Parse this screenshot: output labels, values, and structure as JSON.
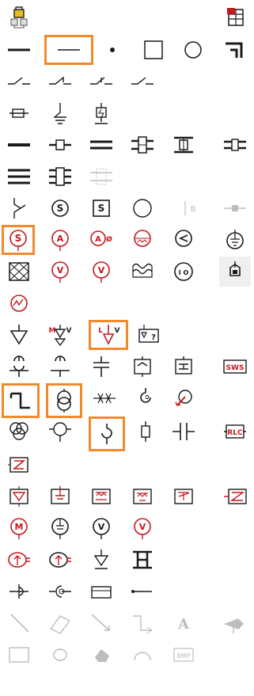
{
  "toolbar": {
    "top_left_icon": "lock-network-icon",
    "top_right_icon": "table-grid-icon"
  },
  "labels": {
    "b": "B",
    "mv": "M",
    "vv": "V",
    "lv_l": "L",
    "lv_v": "V",
    "qm": "?",
    "sws": "SWS",
    "rlc": "RLC",
    "io": "I O",
    "bmp": "BMP",
    "text_a": "A",
    "s1": "S",
    "s2": "S",
    "s3": "S",
    "a1": "A",
    "ad_a": "A",
    "ad_d": "Ø",
    "v1": "V",
    "v2": "V",
    "m": "M",
    "v3": "V",
    "v4": "V"
  },
  "selected_tools": [
    "line-tool",
    "meter-s-tool",
    "step-line-tool",
    "transformer-tool",
    "ground-lv-tool",
    "hook-tool"
  ],
  "colors": {
    "dark": "#1a1a1a",
    "red": "#c4181b",
    "gray": "#bdbdbd",
    "selection": "#f08a2c"
  }
}
